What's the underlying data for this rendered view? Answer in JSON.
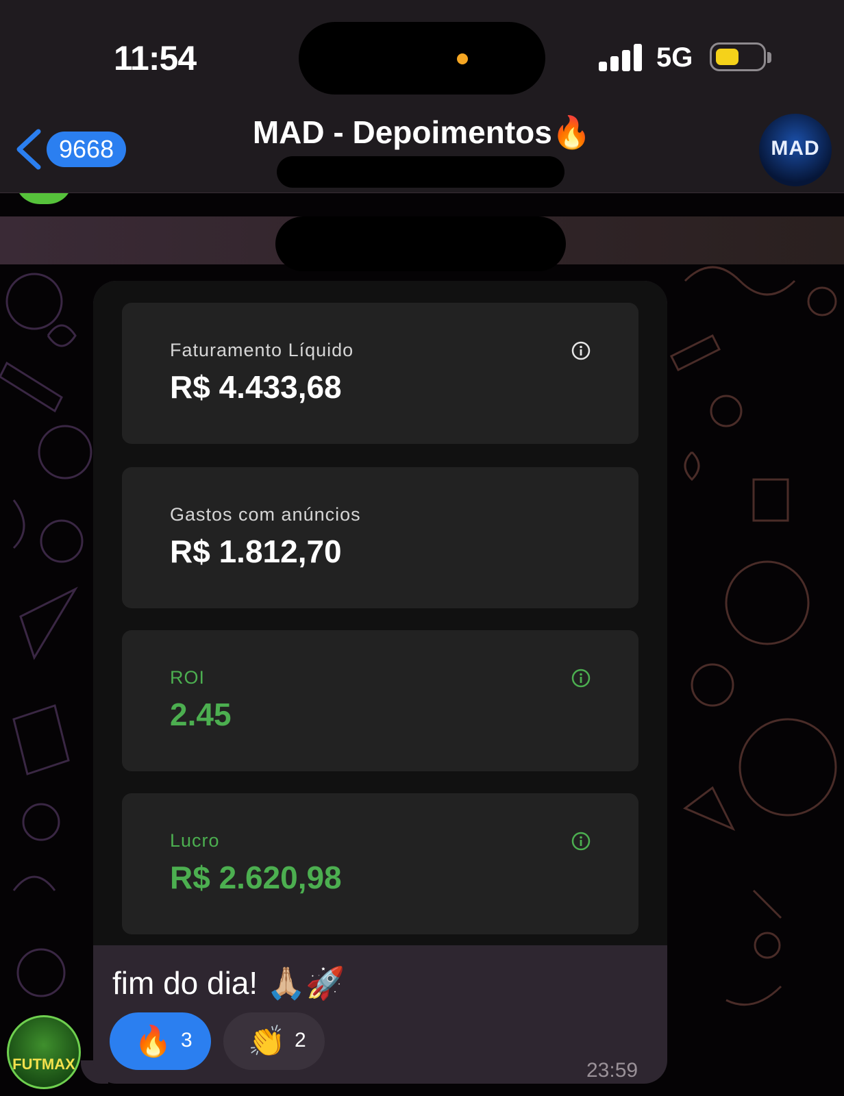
{
  "status_bar": {
    "time": "11:54",
    "network": "5G",
    "battery_level": 0.35,
    "battery_color": "#f5d21a"
  },
  "header": {
    "back_icon": "chevron-left-icon",
    "unread_count": "9668",
    "title": "MAD - Depoimentos🔥",
    "avatar_text": "MAD"
  },
  "message": {
    "cards": [
      {
        "label": "Faturamento Líquido",
        "value": "R$ 4.433,68",
        "info_icon": true,
        "accent": "#ffffff"
      },
      {
        "label": "Gastos com anúncios",
        "value": "R$ 1.812,70",
        "info_icon": false,
        "accent": "#ffffff"
      },
      {
        "label": "ROI",
        "value": "2.45",
        "info_icon": true,
        "accent": "#4caf50"
      },
      {
        "label": "Lucro",
        "value": "R$ 2.620,98",
        "info_icon": true,
        "accent": "#4caf50"
      }
    ],
    "caption": "fim do dia! 🙏🏼🚀",
    "reactions": [
      {
        "emoji": "🔥",
        "count": "3",
        "selected": true
      },
      {
        "emoji": "👏",
        "count": "2",
        "selected": false
      }
    ],
    "time": "23:59"
  },
  "sender": {
    "avatar_text": "FUTMAX"
  },
  "colors": {
    "accent_blue": "#2b7ff0",
    "profit_green": "#4caf50",
    "bubble": "#2e2630"
  }
}
